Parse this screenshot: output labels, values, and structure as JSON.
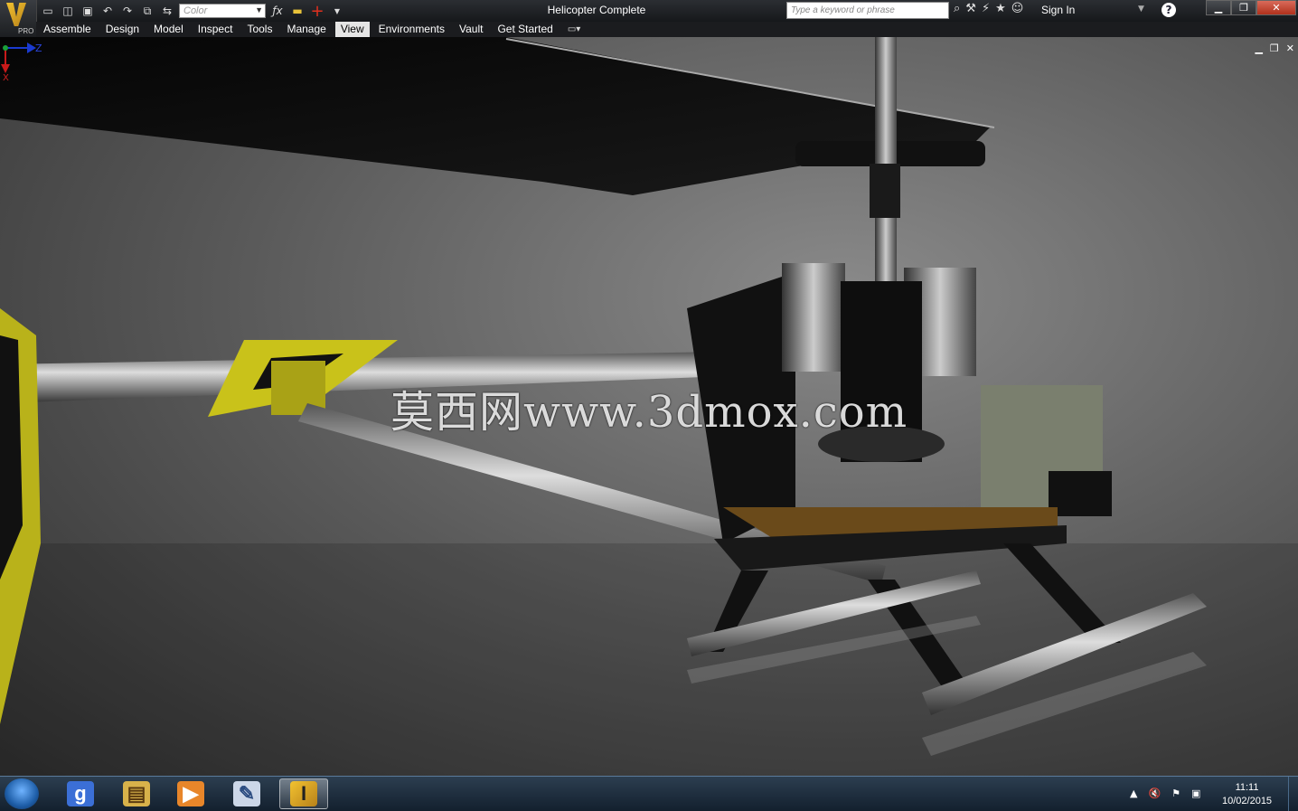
{
  "app": {
    "badge": "PRO",
    "window_title": "Helicopter Complete"
  },
  "quick_access": {
    "color_placeholder": "Color",
    "search_placeholder": "Type a keyword or phrase",
    "sign_in": "Sign In",
    "help": "?"
  },
  "menu": {
    "items": [
      "Assemble",
      "Design",
      "Model",
      "Inspect",
      "Tools",
      "Manage",
      "View",
      "Environments",
      "Vault",
      "Get Started"
    ],
    "active": "View"
  },
  "viewport": {
    "watermark": "莫西网www.3dmox.com",
    "axis": {
      "z_label": "Z",
      "x_label": "X"
    }
  },
  "taskbar": {
    "apps": [
      {
        "name": "google-chrome",
        "glyph": "g"
      },
      {
        "name": "file-explorer",
        "glyph": "▤"
      },
      {
        "name": "media-player",
        "glyph": "▶"
      },
      {
        "name": "paint",
        "glyph": "✎"
      },
      {
        "name": "inventor",
        "glyph": "I",
        "active": true
      }
    ],
    "clock": {
      "time": "11:11",
      "date": "10/02/2015"
    }
  },
  "colors": {
    "titlebar": "#1c1e21",
    "menubar": "#1b1c1f",
    "active_menu": "#e5e5e5",
    "canopy_yellow": "#c9c21a",
    "taskbar": "#1f3145"
  }
}
